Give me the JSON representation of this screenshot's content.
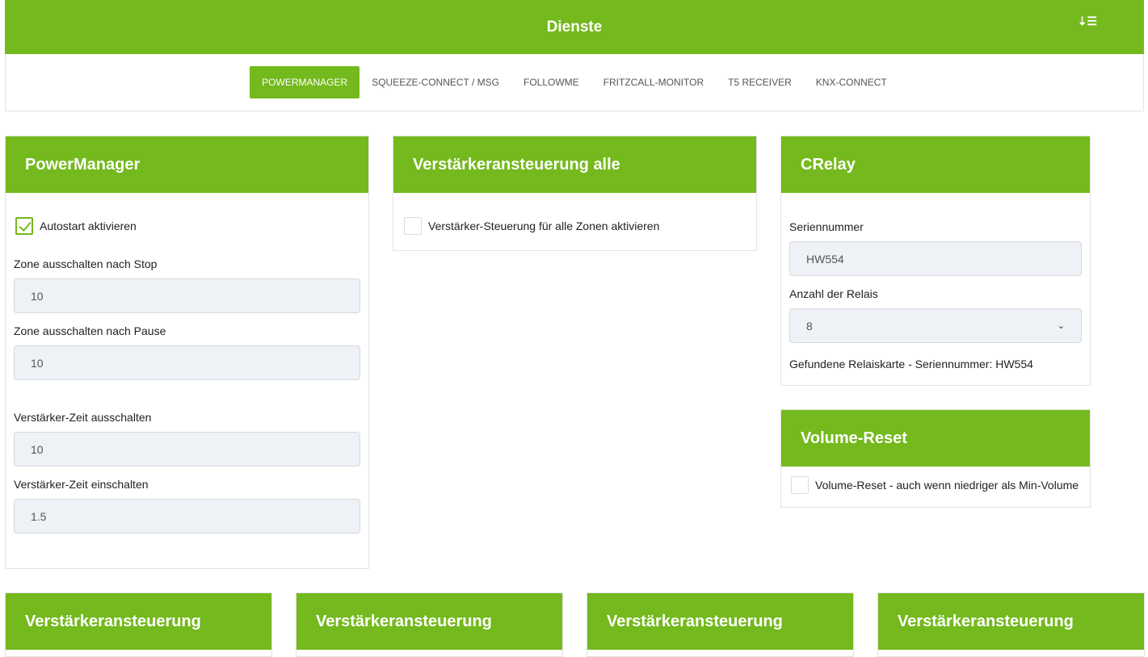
{
  "header": {
    "title": "Dienste",
    "sort_icon": "sort-desc-icon"
  },
  "tabs": [
    {
      "label": "POWERMANAGER"
    },
    {
      "label": "SQUEEZE-CONNECT / MSG"
    },
    {
      "label": "FOLLOWME"
    },
    {
      "label": "FRITZCALL-MONITOR"
    },
    {
      "label": "T5 RECEIVER"
    },
    {
      "label": "KNX-CONNECT"
    }
  ],
  "powermanager": {
    "title": "PowerManager",
    "autostart": "Autostart aktivieren",
    "autostart_checked": true,
    "fields": [
      {
        "label": "Zone ausschalten nach Stop",
        "value": "10"
      },
      {
        "label": "Zone ausschalten nach Pause",
        "value": "10"
      },
      {
        "label": "Verstärker-Zeit ausschalten",
        "value": "10"
      },
      {
        "label": "Verstärker-Zeit einschalten",
        "value": "1.5"
      }
    ]
  },
  "amp_all": {
    "title": "Verstärkeransteuerung alle",
    "checkbox": "Verstärker-Steuerung für alle Zonen aktivieren"
  },
  "crelay": {
    "title": "CRelay",
    "serial_label": "Seriennummer",
    "serial_value": "HW554",
    "relay_label": "Anzahl der Relais",
    "relay_value": "8",
    "found": "Gefundene Relaiskarte - Seriennummer: HW554"
  },
  "volume_reset": {
    "title": "Volume-Reset",
    "checkbox": "Volume-Reset - auch wenn niedriger als Min-Volume"
  },
  "bottom_cards": [
    {
      "title": "Verstärkeransteuerung"
    },
    {
      "title": "Verstärkeransteuerung"
    },
    {
      "title": "Verstärkeransteuerung"
    },
    {
      "title": "Verstärkeransteuerung"
    }
  ]
}
